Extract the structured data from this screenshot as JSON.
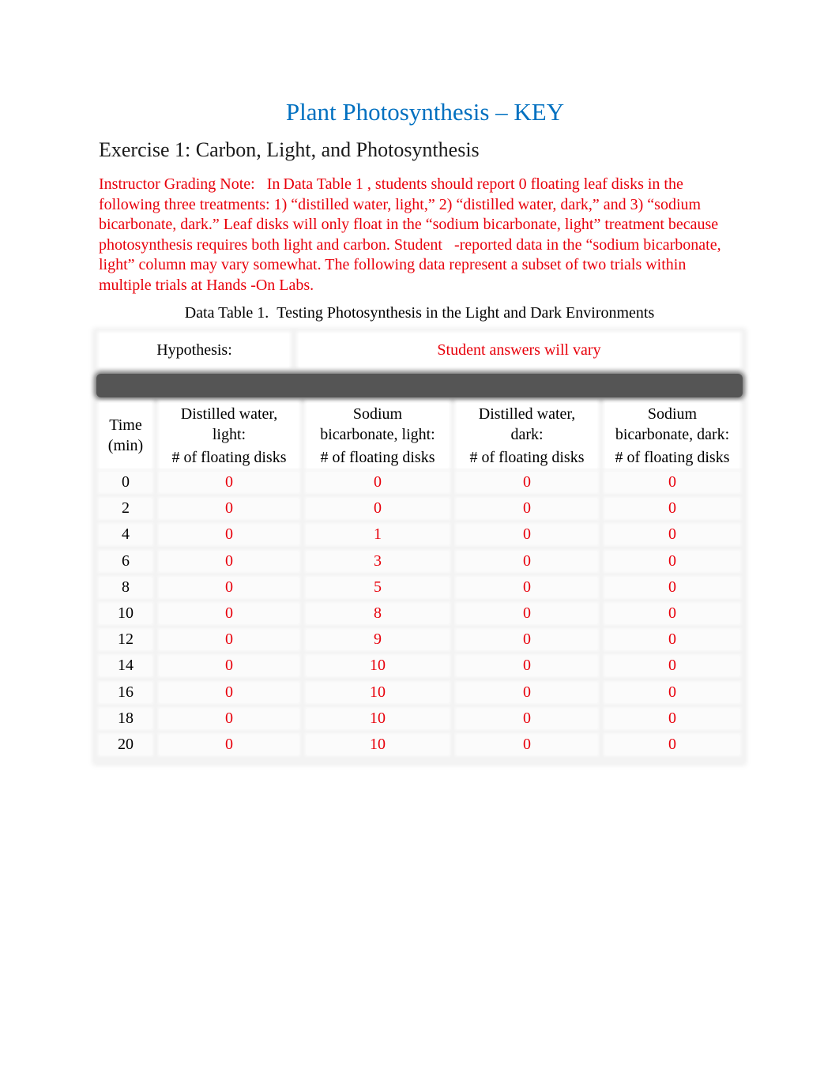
{
  "document": {
    "title": "Plant Photosynthesis – KEY",
    "exercise_heading": "Exercise 1: Carbon, Light, and Photosynthesis",
    "grading_note": "Instructor Grading Note:   In Data Table 1 , students should report 0 floating leaf disks in the following three treatments: 1) “distilled water, light,” 2) “distilled water, dark,” and 3) “sodium bicarbonate, dark.” Leaf disks will only float in the “sodium bicarbonate, light” treatment because photosynthesis requires both light and carbon. Student   -reported data in the “sodium bicarbonate, light” column may vary somewhat. The following data represent a subset of two trials within multiple trials at Hands -On Labs.",
    "colors": {
      "title": "#0070C0",
      "answer_text": "#e8000b",
      "body_text": "#000000"
    }
  },
  "table": {
    "caption": "Data Table 1. Testing Photosynthesis in the Light and Dark Environments",
    "hypothesis_label": "Hypothesis:",
    "hypothesis_value": "Student answers will vary",
    "headers": [
      [
        "Time",
        "(min)"
      ],
      [
        "Distilled water,",
        "light:",
        "# of floating disks"
      ],
      [
        "Sodium",
        "bicarbonate, light:",
        "# of floating disks"
      ],
      [
        "Distilled water,",
        "dark:",
        "# of floating disks"
      ],
      [
        "Sodium",
        "bicarbonate, dark:",
        "# of floating disks"
      ]
    ],
    "rows": [
      [
        "0",
        "0",
        "0",
        "0",
        "0"
      ],
      [
        "2",
        "0",
        "0",
        "0",
        "0"
      ],
      [
        "4",
        "0",
        "1",
        "0",
        "0"
      ],
      [
        "6",
        "0",
        "3",
        "0",
        "0"
      ],
      [
        "8",
        "0",
        "5",
        "0",
        "0"
      ],
      [
        "10",
        "0",
        "8",
        "0",
        "0"
      ],
      [
        "12",
        "0",
        "9",
        "0",
        "0"
      ],
      [
        "14",
        "0",
        "10",
        "0",
        "0"
      ],
      [
        "16",
        "0",
        "10",
        "0",
        "0"
      ],
      [
        "18",
        "0",
        "10",
        "0",
        "0"
      ],
      [
        "20",
        "0",
        "10",
        "0",
        "0"
      ]
    ]
  }
}
